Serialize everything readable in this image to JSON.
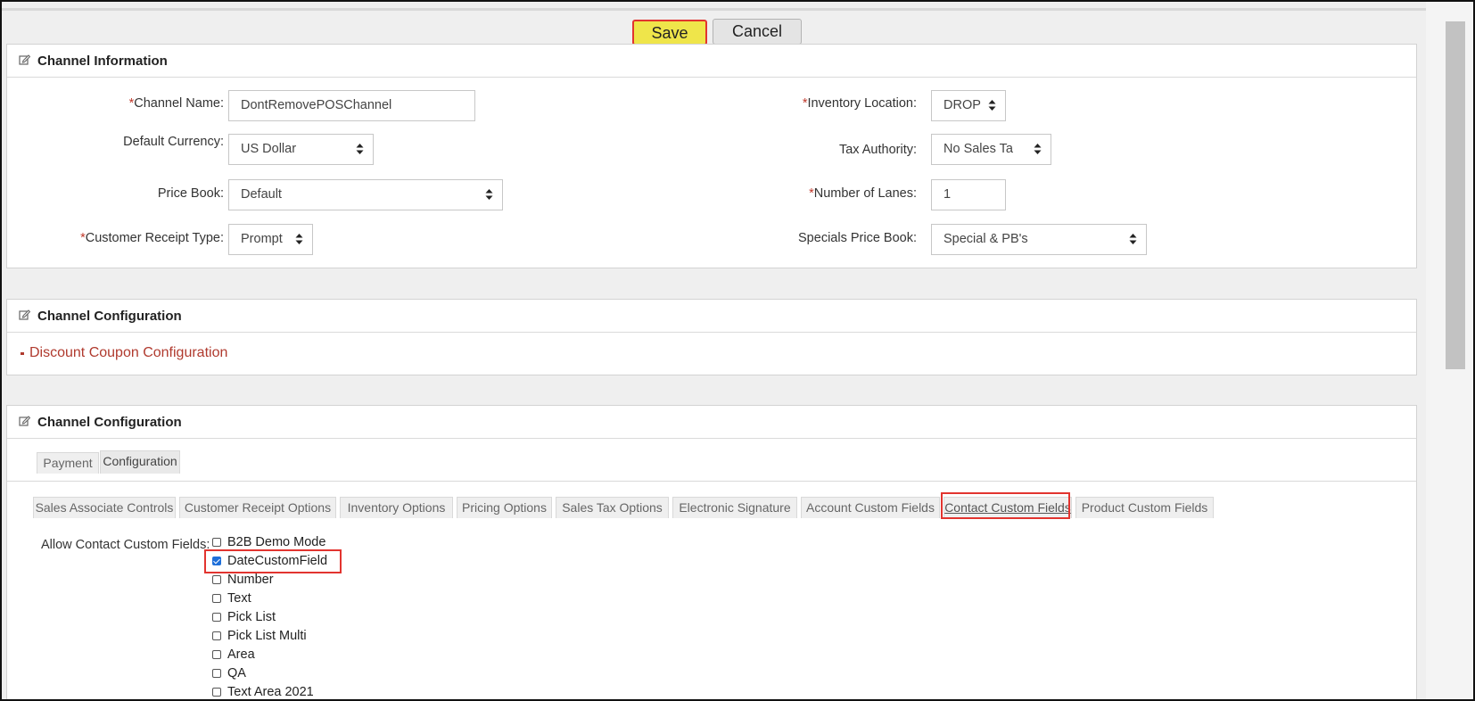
{
  "toolbar": {
    "save_label": "Save",
    "cancel_label": "Cancel"
  },
  "channel_info": {
    "title": "Channel Information",
    "fields": {
      "channel_name": {
        "label": "Channel Name:",
        "required": "*",
        "value": "DontRemovePOSChannel"
      },
      "default_currency": {
        "label": "Default Currency:",
        "value": "US Dollar"
      },
      "price_book": {
        "label": "Price Book:",
        "value": "Default"
      },
      "customer_receipt_type": {
        "label": "Customer Receipt Type:",
        "required": "*",
        "value": "Prompt"
      },
      "inventory_location": {
        "label": "Inventory Location:",
        "required": "*",
        "value": "DROP"
      },
      "tax_authority": {
        "label": "Tax Authority:",
        "value": "No Sales Ta"
      },
      "number_of_lanes": {
        "label": "Number of Lanes:",
        "required": "*",
        "value": "1"
      },
      "specials_price_book": {
        "label": "Specials Price Book:",
        "value": "Special & PB's"
      }
    }
  },
  "channel_config_1": {
    "title": "Channel Configuration",
    "link": "Discount Coupon Configuration"
  },
  "channel_config_2": {
    "title": "Channel Configuration",
    "top_tabs": [
      "Payment",
      "Configuration"
    ],
    "sub_tabs": [
      "Sales Associate Controls",
      "Customer Receipt Options",
      "Inventory Options",
      "Pricing Options",
      "Sales Tax Options",
      "Electronic Signature",
      "Account Custom Fields",
      "Contact Custom Fields",
      "Product Custom Fields"
    ],
    "custom_fields_label": "Allow Contact Custom Fields:",
    "custom_fields": [
      {
        "label": "B2B Demo Mode",
        "checked": false
      },
      {
        "label": "DateCustomField",
        "checked": true
      },
      {
        "label": "Number",
        "checked": false
      },
      {
        "label": "Text",
        "checked": false
      },
      {
        "label": "Pick List",
        "checked": false
      },
      {
        "label": "Pick List Multi",
        "checked": false
      },
      {
        "label": "Area",
        "checked": false
      },
      {
        "label": "QA",
        "checked": false
      },
      {
        "label": "Text Area 2021",
        "checked": false
      }
    ]
  },
  "colors": {
    "accent_save": "#efe54a",
    "highlight": "#e2342f",
    "required": "#c0392b",
    "link": "#b03a2e"
  },
  "icons": {
    "panel_edit": "edit-icon",
    "select_arrows": "sort-arrows-icon"
  }
}
